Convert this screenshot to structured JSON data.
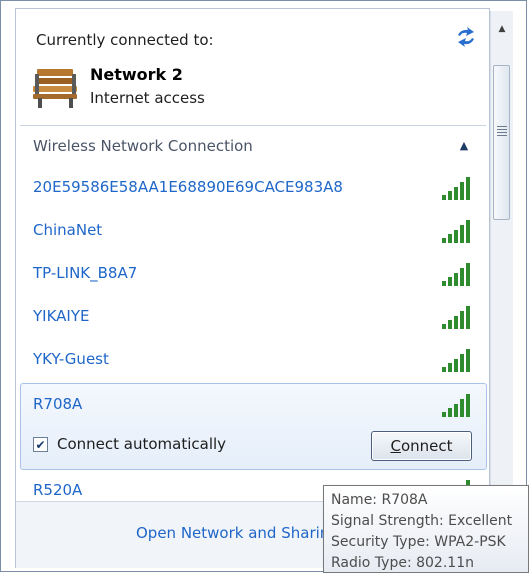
{
  "header": {
    "current_label": "Currently connected to:",
    "network_name": "Network  2",
    "network_status": "Internet access",
    "refresh_icon": "refresh-icon",
    "network_icon": "bench-icon"
  },
  "section": {
    "title": "Wireless Network Connection",
    "collapse_icon": "chevron-up-icon"
  },
  "networks": [
    {
      "name": "20E59586E58AA1E68890E69CACE983A8",
      "signal": "excellent"
    },
    {
      "name": "ChinaNet",
      "signal": "excellent"
    },
    {
      "name": "TP-LINK_B8A7",
      "signal": "excellent"
    },
    {
      "name": "YIKAIYE",
      "signal": "excellent"
    },
    {
      "name": "YKY-Guest",
      "signal": "excellent"
    },
    {
      "name": "R708A",
      "signal": "excellent"
    },
    {
      "name": "R520A",
      "signal": "excellent"
    }
  ],
  "selected": {
    "connect_auto_label": "Connect automatically",
    "connect_auto_checked": true,
    "connect_button_mnemonic": "C",
    "connect_button_rest": "onnect"
  },
  "footer": {
    "link": "Open Network and Sharing Center"
  },
  "tooltip": {
    "line1": "Name: R708A",
    "line2": "Signal Strength: Excellent",
    "line3": "Security Type: WPA2-PSK",
    "line4": "Radio Type: 802.11n"
  },
  "colors": {
    "link": "#1f66c9",
    "signal": "#2e8b2e",
    "selection": "#e5eefa"
  }
}
